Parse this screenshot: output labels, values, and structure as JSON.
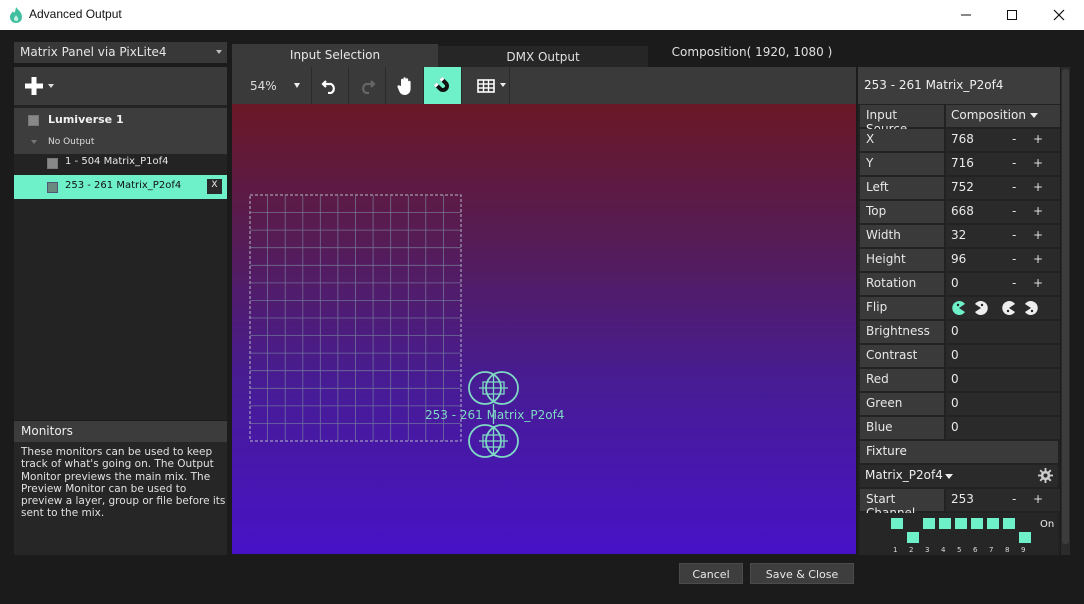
{
  "window": {
    "title": "Advanced Output"
  },
  "left": {
    "output_select": "Matrix Panel via PixLite4",
    "layers": [
      {
        "label": "Lumiverse 1"
      },
      {
        "label": "No Output"
      },
      {
        "label": "1 - 504 Matrix_P1of4"
      },
      {
        "label": "253 - 261 Matrix_P2of4",
        "remove": "X"
      }
    ],
    "monitors_title": "Monitors",
    "monitors_text": "These monitors can be used to keep track of what's going on. The Output Monitor previews the main mix. The Preview Monitor can be used to preview a layer, group or file before its sent to the mix."
  },
  "tabs": {
    "input": "Input Selection",
    "dmx": "DMX Output",
    "composition": "Composition( 1920, 1080 )"
  },
  "toolbar": {
    "zoom": "54%"
  },
  "canvas": {
    "fixture_label": "253 - 261 Matrix_P2of4"
  },
  "props": {
    "header": "253 - 261 Matrix_P2of4",
    "input_source_label": "Input Source",
    "input_source_value": "Composition",
    "minus": "-",
    "plus": "+",
    "rows": [
      {
        "label": "X",
        "value": "768"
      },
      {
        "label": "Y",
        "value": "716"
      },
      {
        "label": "Left",
        "value": "752"
      },
      {
        "label": "Top",
        "value": "668"
      },
      {
        "label": "Width",
        "value": "32"
      },
      {
        "label": "Height",
        "value": "96"
      },
      {
        "label": "Rotation",
        "value": "0"
      }
    ],
    "flip_label": "Flip",
    "sliders": [
      {
        "label": "Brightness",
        "value": "0",
        "color": "#3a8a70"
      },
      {
        "label": "Contrast",
        "value": "0",
        "color": "#3a8a70"
      },
      {
        "label": "Red",
        "value": "0",
        "color": "#e01010"
      },
      {
        "label": "Green",
        "value": "0",
        "color": "#10d010"
      },
      {
        "label": "Blue",
        "value": "0",
        "color": "#1010e0"
      }
    ],
    "fixture_title": "Fixture",
    "fixture_value": "Matrix_P2of4",
    "start_channel_label": "Start Channel",
    "start_channel_value": "253",
    "channels": [
      "1",
      "2",
      "3",
      "4",
      "5",
      "6",
      "7",
      "8",
      "9"
    ],
    "on_label": "On"
  },
  "buttons": {
    "cancel": "Cancel",
    "save": "Save & Close"
  },
  "colors": {
    "accent": "#6ef0c8"
  }
}
